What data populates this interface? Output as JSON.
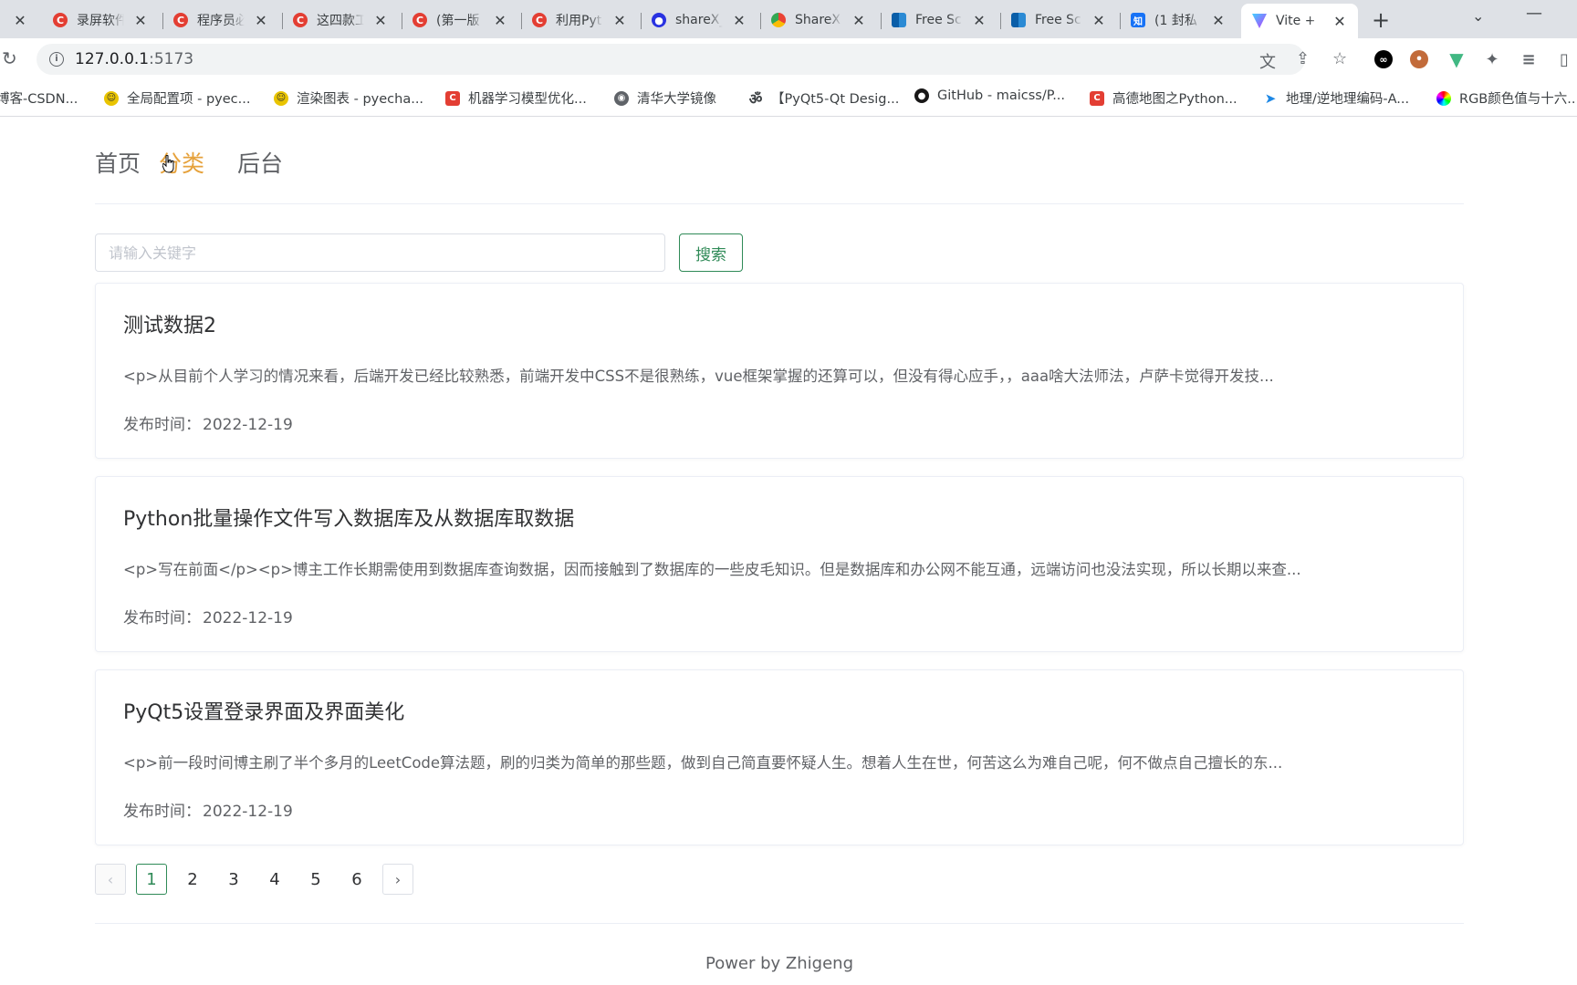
{
  "browser": {
    "tabs": [
      {
        "label": "录屏软件",
        "icon": "csdn"
      },
      {
        "label": "程序员必",
        "icon": "csdn"
      },
      {
        "label": "这四款工",
        "icon": "csdn"
      },
      {
        "label": "(第一版",
        "icon": "csdn"
      },
      {
        "label": "利用Pyt",
        "icon": "csdn"
      },
      {
        "label": "shareX_",
        "icon": "baidu"
      },
      {
        "label": "ShareX",
        "icon": "chrome"
      },
      {
        "label": "Free Sc",
        "icon": "ms"
      },
      {
        "label": "Free Sc",
        "icon": "ms"
      },
      {
        "label": "(1 封私",
        "icon": "zhihu"
      },
      {
        "label": "Vite +",
        "icon": "vite",
        "active": true
      }
    ],
    "address": {
      "host": "127.0.0.1",
      "port": ":5173"
    },
    "bookmarks": [
      {
        "label": "博客-CSDN...",
        "icon": "csdn"
      },
      {
        "label": "全局配置项 - pyec...",
        "icon": "pye"
      },
      {
        "label": "渲染图表 - pyecha...",
        "icon": "pye"
      },
      {
        "label": "机器学习模型优化...",
        "icon": "csdn"
      },
      {
        "label": "清华大学镜像",
        "icon": "tsinghua"
      },
      {
        "label": "【PyQt5-Qt Desig...",
        "icon": "om"
      },
      {
        "label": "GitHub - maicss/P...",
        "icon": "gh"
      },
      {
        "label": "高德地图之Python...",
        "icon": "csdn"
      },
      {
        "label": "地理/逆地理编码-A...",
        "icon": "plane"
      },
      {
        "label": "RGB颜色值与十六...",
        "icon": "rainbow"
      }
    ]
  },
  "nav": {
    "home": "首页",
    "category": "分类",
    "admin": "后台"
  },
  "search": {
    "placeholder": "请输入关键字",
    "button": "搜索"
  },
  "articles": [
    {
      "title": "测试数据2",
      "summary": "<p>从目前个人学习的情况来看，后端开发已经比较熟悉，前端开发中CSS不是很熟练，vue框架掌握的还算可以，但没有得心应手，，aaa啥大法师法，卢萨卡觉得开发技...",
      "date_label": "发布时间：",
      "date": "2022-12-19"
    },
    {
      "title": "Python批量操作文件写入数据库及从数据库取数据",
      "summary": "<p>写在前面</p><p>博主工作长期需使用到数据库查询数据，因而接触到了数据库的一些皮毛知识。但是数据库和办公网不能互通，远端访问也没法实现，所以长期以来查...",
      "date_label": "发布时间：",
      "date": "2022-12-19"
    },
    {
      "title": "PyQt5设置登录界面及界面美化",
      "summary": "<p>前一段时间博主刷了半个多月的LeetCode算法题，刷的归类为简单的那些题，做到自己简直要怀疑人生。想着人生在世，何苦这么为难自己呢，何不做点自己擅长的东...",
      "date_label": "发布时间：",
      "date": "2022-12-19"
    }
  ],
  "pagination": {
    "prev": "‹",
    "next": "›",
    "pages": [
      "1",
      "2",
      "3",
      "4",
      "5",
      "6"
    ],
    "current": "1"
  },
  "footer": "Power by Zhigeng",
  "colors": {
    "accent_active_nav": "#e6a23c",
    "primary_green": "#2f8a57"
  }
}
